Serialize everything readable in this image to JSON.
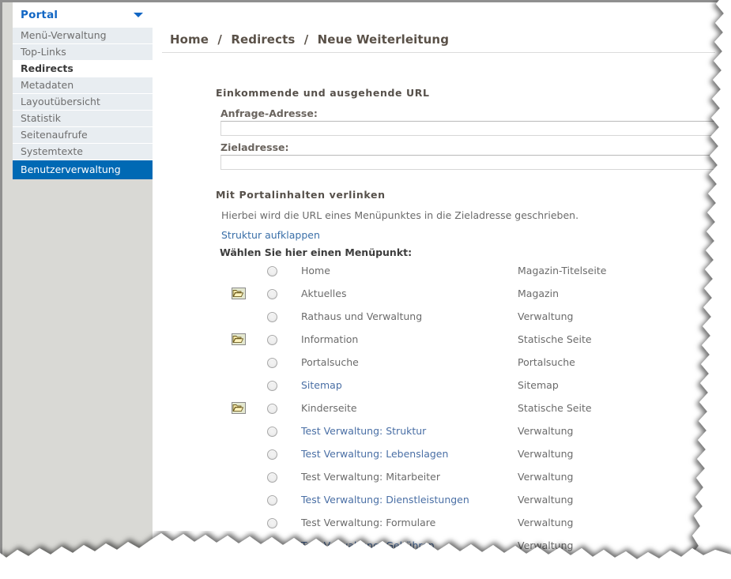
{
  "sidebar": {
    "title": "Portal",
    "caret_icon": "chevron-down-icon",
    "items": [
      {
        "label": "Menü-Verwaltung",
        "state": "normal"
      },
      {
        "label": "Top-Links",
        "state": "normal"
      },
      {
        "label": "Redirects",
        "state": "current"
      },
      {
        "label": "Metadaten",
        "state": "normal"
      },
      {
        "label": "Layoutübersicht",
        "state": "normal"
      },
      {
        "label": "Statistik",
        "state": "normal"
      },
      {
        "label": "Seitenaufrufe",
        "state": "normal"
      },
      {
        "label": "Systemtexte",
        "state": "normal"
      },
      {
        "label": "Benutzerverwaltung",
        "state": "active"
      }
    ]
  },
  "breadcrumb": {
    "full": "Home / Redirects / Neue Weiterleitung",
    "parts": [
      "Home",
      "Redirects",
      "Neue Weiterleitung"
    ],
    "separator": "/"
  },
  "url_section": {
    "heading": "Einkommende und ausgehende URL",
    "fields": [
      {
        "label": "Anfrage-Adresse:",
        "value": "",
        "placeholder": ""
      },
      {
        "label": "Zieladresse:",
        "value": "",
        "placeholder": ""
      }
    ]
  },
  "link_section": {
    "heading": "Mit Portalinhalten verlinken",
    "description": "Hierbei wird die URL eines Menüpunktes in die Zieladresse geschrieben.",
    "expand_link": "Struktur aufklappen",
    "choose_label": "Wählen Sie hier einen Menüpunkt:"
  },
  "tree": {
    "rows": [
      {
        "folder": false,
        "label": "Home",
        "style": "gray",
        "type": "Magazin-Titelseite"
      },
      {
        "folder": true,
        "label": "Aktuelles",
        "style": "gray",
        "type": "Magazin"
      },
      {
        "folder": false,
        "label": "Rathaus und Verwaltung",
        "style": "gray",
        "type": "Verwaltung"
      },
      {
        "folder": true,
        "label": "Information",
        "style": "gray",
        "type": "Statische Seite"
      },
      {
        "folder": false,
        "label": "Portalsuche",
        "style": "gray",
        "type": "Portalsuche"
      },
      {
        "folder": false,
        "label": "Sitemap",
        "style": "blue",
        "type": "Sitemap"
      },
      {
        "folder": true,
        "label": "Kinderseite",
        "style": "gray",
        "type": "Statische Seite"
      },
      {
        "folder": false,
        "label": "Test Verwaltung: Struktur",
        "style": "blue",
        "type": "Verwaltung"
      },
      {
        "folder": false,
        "label": "Test Verwaltung: Lebenslagen",
        "style": "blue",
        "type": "Verwaltung"
      },
      {
        "folder": false,
        "label": "Test Verwaltung: Mitarbeiter",
        "style": "gray",
        "type": "Verwaltung"
      },
      {
        "folder": false,
        "label": "Test Verwaltung: Dienstleistungen",
        "style": "blue",
        "type": "Verwaltung"
      },
      {
        "folder": false,
        "label": "Test Verwaltung: Formulare",
        "style": "gray",
        "type": "Verwaltung"
      },
      {
        "folder": false,
        "label": "Test Verwaltung: Gebühren",
        "style": "blue",
        "type": "Verwaltung"
      }
    ],
    "radio_name": "menu-item-radio",
    "folder_icon": "folder-open-icon"
  },
  "colors": {
    "accent_blue": "#0069b4",
    "title_blue": "#1166c4",
    "link_blue": "#4a6fa5",
    "sidebar_bg": "#d9d9d5",
    "nav_bg": "#e8edf1",
    "text_gray": "#6b6b6b",
    "breadcrumb_brown": "#5a5148"
  }
}
